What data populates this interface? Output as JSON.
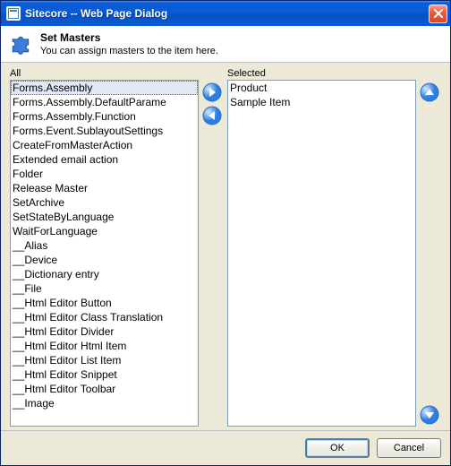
{
  "window": {
    "title": "Sitecore -- Web Page Dialog"
  },
  "header": {
    "title": "Set Masters",
    "subtitle": "You can assign masters to the item here."
  },
  "labels": {
    "all": "All",
    "selected": "Selected"
  },
  "lists": {
    "all_selected_index": 0,
    "all": [
      "Forms.Assembly",
      "Forms.Assembly.DefaultParame",
      "Forms.Assembly.Function",
      "Forms.Event.SublayoutSettings",
      "CreateFromMasterAction",
      "Extended email action",
      "Folder",
      "Release Master",
      "SetArchive",
      "SetStateByLanguage",
      "WaitForLanguage",
      "__Alias",
      "__Device",
      "__Dictionary entry",
      "__File",
      "__Html Editor Button",
      "__Html Editor Class Translation",
      "__Html Editor Divider",
      "__Html Editor Html Item",
      "__Html Editor List Item",
      "__Html Editor Snippet",
      "__Html Editor Toolbar",
      "__Image"
    ],
    "selected": [
      "Product",
      "Sample Item"
    ]
  },
  "buttons": {
    "ok": "OK",
    "cancel": "Cancel"
  },
  "icons": {
    "close": "close-icon",
    "puzzle": "puzzle-icon",
    "add": "arrow-right-icon",
    "remove": "arrow-left-icon",
    "up": "arrow-up-icon",
    "down": "arrow-down-icon"
  }
}
